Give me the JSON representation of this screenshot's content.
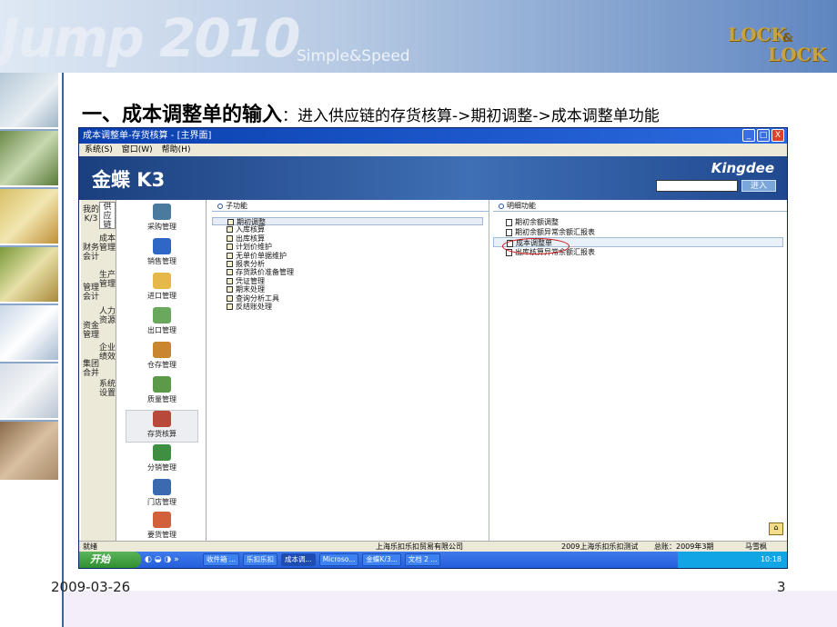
{
  "slide": {
    "bg_text": "Jump 2010",
    "bg_subtext": "Simple&Speed",
    "logo_top": "LOCK",
    "logo_amp": "&",
    "logo_bottom": "LOCK",
    "title_main": "一、成本调整单的输入",
    "title_colon": "：",
    "title_sub": "进入供应链的存货核算->期初调整->成本调整单功能",
    "date": "2009-03-26",
    "page": "3"
  },
  "window": {
    "title": "成本调整单-存货核算 - [主界面]",
    "controls": {
      "min": "_",
      "max": "□",
      "close": "X"
    },
    "menu": [
      "系统(S)",
      "窗口(W)",
      "帮助(H)"
    ],
    "banner_brand": "金蝶 K3",
    "banner_kingdee": "Kingdee",
    "go_button": "进入"
  },
  "vertical_tabs": [
    "我的K/3",
    "供应链",
    "财务会计",
    "成本管理",
    "管理会计",
    "生产管理",
    "资金管理",
    "人力资源",
    "集团合并",
    "企业绩效",
    "系统设置"
  ],
  "modules": [
    {
      "label": "采购管理",
      "icon": "purchase-icon",
      "color": "#4a7a9e"
    },
    {
      "label": "销售管理",
      "icon": "sales-truck-icon",
      "color": "#2f67c6"
    },
    {
      "label": "进口管理",
      "icon": "import-box-icon",
      "color": "#e6b84a"
    },
    {
      "label": "出口管理",
      "icon": "export-icon",
      "color": "#6aa85e"
    },
    {
      "label": "仓存管理",
      "icon": "warehouse-icon",
      "color": "#c8862e"
    },
    {
      "label": "质量管理",
      "icon": "quality-icon",
      "color": "#5c9a4a"
    },
    {
      "label": "存货核算",
      "icon": "inventory-calc-icon",
      "color": "#b8483a"
    },
    {
      "label": "分销管理",
      "icon": "distribution-icon",
      "color": "#3f8e42"
    },
    {
      "label": "门店管理",
      "icon": "store-icon",
      "color": "#3a6ab0"
    },
    {
      "label": "要货管理",
      "icon": "order-icon",
      "color": "#d2603a"
    }
  ],
  "sub_panel": {
    "header": "子功能",
    "items": [
      "期初调整",
      "入库核算",
      "出库核算",
      "计划价维护",
      "无单价单据维护",
      "报表分析",
      "存货跌价准备管理",
      "凭证管理",
      "期末处理",
      "查询分析工具",
      "反结账处理"
    ]
  },
  "detail_panel": {
    "header": "明细功能",
    "items": [
      "期初余额调整",
      "期初余额异常余额汇报表",
      "成本调整单",
      "出库核算异常余额汇报表"
    ]
  },
  "status": {
    "left": "就绪",
    "company": "上海乐扣乐扣贸易有限公司",
    "account": "2009上海乐扣乐扣测试",
    "period": "总账：2009年3期",
    "user": "马雪枫"
  },
  "taskbar": {
    "start": "开始",
    "tasks": [
      "收件箱 ...",
      "乐扣乐扣",
      "成本调...",
      "Microso...",
      "金蝶K/3...",
      "文档 2 ..."
    ],
    "time": "10:18"
  },
  "colors": {
    "accent": "#2b5fb4",
    "title_bar": "#0a3fae",
    "highlight_oval": "#d01818"
  }
}
